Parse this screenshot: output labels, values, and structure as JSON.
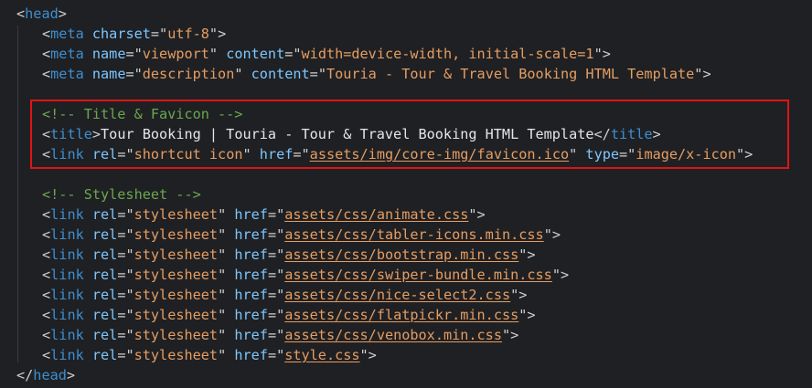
{
  "editor": {
    "lines": [
      {
        "parts": [
          [
            "p",
            "<"
          ],
          [
            "t",
            "head"
          ],
          [
            "p",
            ">"
          ]
        ]
      },
      {
        "parts": [
          [
            "p",
            "<"
          ],
          [
            "t",
            "meta"
          ],
          [
            "sp",
            " "
          ],
          [
            "a",
            "charset"
          ],
          [
            "p",
            "=\""
          ],
          [
            "s",
            "utf-8"
          ],
          [
            "p",
            "\">"
          ]
        ]
      },
      {
        "parts": [
          [
            "p",
            "<"
          ],
          [
            "t",
            "meta"
          ],
          [
            "sp",
            " "
          ],
          [
            "a",
            "name"
          ],
          [
            "p",
            "=\""
          ],
          [
            "s",
            "viewport"
          ],
          [
            "p",
            "\" "
          ],
          [
            "a",
            "content"
          ],
          [
            "p",
            "=\""
          ],
          [
            "s",
            "width=device-width, initial-scale=1"
          ],
          [
            "p",
            "\">"
          ]
        ]
      },
      {
        "parts": [
          [
            "p",
            "<"
          ],
          [
            "t",
            "meta"
          ],
          [
            "sp",
            " "
          ],
          [
            "a",
            "name"
          ],
          [
            "p",
            "=\""
          ],
          [
            "s",
            "description"
          ],
          [
            "p",
            "\" "
          ],
          [
            "a",
            "content"
          ],
          [
            "p",
            "=\""
          ],
          [
            "s",
            "Touria - Tour & Travel Booking HTML Template"
          ],
          [
            "p",
            "\">"
          ]
        ]
      },
      {
        "parts": []
      },
      {
        "parts": [
          [
            "c",
            "<!-- Title & Favicon -->"
          ]
        ]
      },
      {
        "parts": [
          [
            "p",
            "<"
          ],
          [
            "t",
            "title"
          ],
          [
            "p",
            ">"
          ],
          [
            "x",
            "Tour Booking | Touria - Tour & Travel Booking HTML Template"
          ],
          [
            "p",
            "</"
          ],
          [
            "t",
            "title"
          ],
          [
            "p",
            ">"
          ]
        ]
      },
      {
        "parts": [
          [
            "p",
            "<"
          ],
          [
            "t",
            "link"
          ],
          [
            "sp",
            " "
          ],
          [
            "a",
            "rel"
          ],
          [
            "p",
            "=\""
          ],
          [
            "s",
            "shortcut icon"
          ],
          [
            "p",
            "\" "
          ],
          [
            "a",
            "href"
          ],
          [
            "p",
            "=\""
          ],
          [
            "su",
            "assets/img/core-img/favicon.ico"
          ],
          [
            "p",
            "\" "
          ],
          [
            "a",
            "type"
          ],
          [
            "p",
            "=\""
          ],
          [
            "s",
            "image/x-icon"
          ],
          [
            "p",
            "\">"
          ]
        ]
      },
      {
        "parts": []
      },
      {
        "parts": [
          [
            "c",
            "<!-- Stylesheet -->"
          ]
        ]
      },
      {
        "parts": [
          [
            "p",
            "<"
          ],
          [
            "t",
            "link"
          ],
          [
            "sp",
            " "
          ],
          [
            "a",
            "rel"
          ],
          [
            "p",
            "=\""
          ],
          [
            "s",
            "stylesheet"
          ],
          [
            "p",
            "\" "
          ],
          [
            "a",
            "href"
          ],
          [
            "p",
            "=\""
          ],
          [
            "su",
            "assets/css/animate.css"
          ],
          [
            "p",
            "\">"
          ]
        ]
      },
      {
        "parts": [
          [
            "p",
            "<"
          ],
          [
            "t",
            "link"
          ],
          [
            "sp",
            " "
          ],
          [
            "a",
            "rel"
          ],
          [
            "p",
            "=\""
          ],
          [
            "s",
            "stylesheet"
          ],
          [
            "p",
            "\" "
          ],
          [
            "a",
            "href"
          ],
          [
            "p",
            "=\""
          ],
          [
            "su",
            "assets/css/tabler-icons.min.css"
          ],
          [
            "p",
            "\">"
          ]
        ]
      },
      {
        "parts": [
          [
            "p",
            "<"
          ],
          [
            "t",
            "link"
          ],
          [
            "sp",
            " "
          ],
          [
            "a",
            "rel"
          ],
          [
            "p",
            "=\""
          ],
          [
            "s",
            "stylesheet"
          ],
          [
            "p",
            "\" "
          ],
          [
            "a",
            "href"
          ],
          [
            "p",
            "=\""
          ],
          [
            "su",
            "assets/css/bootstrap.min.css"
          ],
          [
            "p",
            "\">"
          ]
        ]
      },
      {
        "parts": [
          [
            "p",
            "<"
          ],
          [
            "t",
            "link"
          ],
          [
            "sp",
            " "
          ],
          [
            "a",
            "rel"
          ],
          [
            "p",
            "=\""
          ],
          [
            "s",
            "stylesheet"
          ],
          [
            "p",
            "\" "
          ],
          [
            "a",
            "href"
          ],
          [
            "p",
            "=\""
          ],
          [
            "su",
            "assets/css/swiper-bundle.min.css"
          ],
          [
            "p",
            "\">"
          ]
        ]
      },
      {
        "parts": [
          [
            "p",
            "<"
          ],
          [
            "t",
            "link"
          ],
          [
            "sp",
            " "
          ],
          [
            "a",
            "rel"
          ],
          [
            "p",
            "=\""
          ],
          [
            "s",
            "stylesheet"
          ],
          [
            "p",
            "\" "
          ],
          [
            "a",
            "href"
          ],
          [
            "p",
            "=\""
          ],
          [
            "su",
            "assets/css/nice-select2.css"
          ],
          [
            "p",
            "\">"
          ]
        ]
      },
      {
        "parts": [
          [
            "p",
            "<"
          ],
          [
            "t",
            "link"
          ],
          [
            "sp",
            " "
          ],
          [
            "a",
            "rel"
          ],
          [
            "p",
            "=\""
          ],
          [
            "s",
            "stylesheet"
          ],
          [
            "p",
            "\" "
          ],
          [
            "a",
            "href"
          ],
          [
            "p",
            "=\""
          ],
          [
            "su",
            "assets/css/flatpickr.min.css"
          ],
          [
            "p",
            "\">"
          ]
        ]
      },
      {
        "parts": [
          [
            "p",
            "<"
          ],
          [
            "t",
            "link"
          ],
          [
            "sp",
            " "
          ],
          [
            "a",
            "rel"
          ],
          [
            "p",
            "=\""
          ],
          [
            "s",
            "stylesheet"
          ],
          [
            "p",
            "\" "
          ],
          [
            "a",
            "href"
          ],
          [
            "p",
            "=\""
          ],
          [
            "su",
            "assets/css/venobox.min.css"
          ],
          [
            "p",
            "\">"
          ]
        ]
      },
      {
        "parts": [
          [
            "p",
            "<"
          ],
          [
            "t",
            "link"
          ],
          [
            "sp",
            " "
          ],
          [
            "a",
            "rel"
          ],
          [
            "p",
            "=\""
          ],
          [
            "s",
            "stylesheet"
          ],
          [
            "p",
            "\" "
          ],
          [
            "a",
            "href"
          ],
          [
            "p",
            "=\""
          ],
          [
            "su",
            "style.css"
          ],
          [
            "p",
            "\">"
          ]
        ]
      },
      {
        "parts": [
          [
            "p",
            "</"
          ],
          [
            "t",
            "head"
          ],
          [
            "p",
            ">"
          ]
        ]
      }
    ]
  },
  "colors": {
    "background": "#1f2023",
    "tag": "#3d8fd1",
    "attribute": "#7cc7ff",
    "string": "#e59d62",
    "comment": "#6aa84f",
    "highlight_border": "#e01414"
  }
}
